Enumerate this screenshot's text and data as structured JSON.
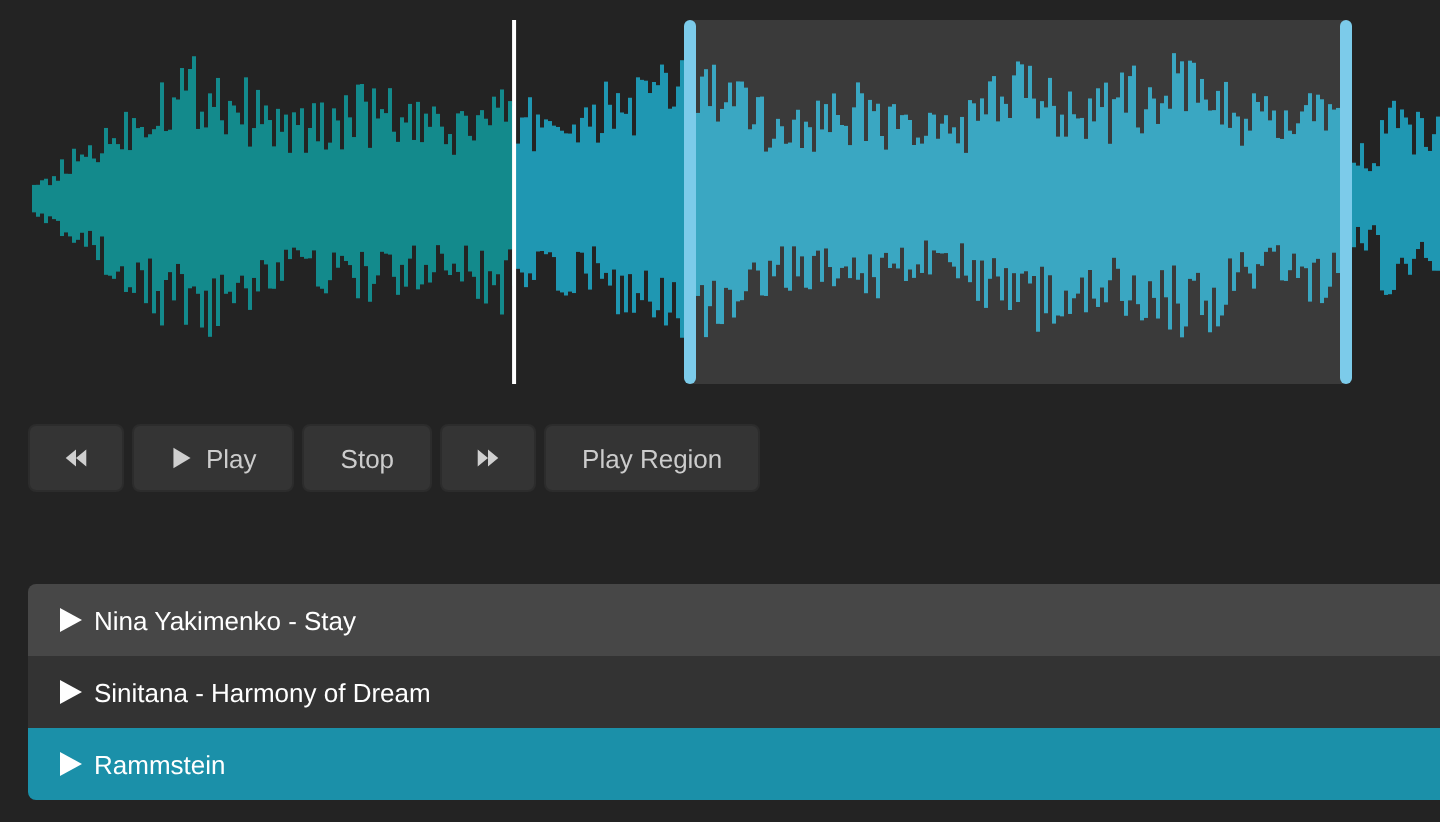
{
  "waveform": {
    "playhead": {
      "level": 0.357
    }
  },
  "controls": [
    {
      "kind": "rewind"
    },
    {
      "kind": "play",
      "label": "Play"
    },
    {
      "kind": "stop",
      "label": "Stop"
    },
    {
      "kind": "forward"
    },
    {
      "kind": "region",
      "label": "Play Region"
    }
  ],
  "playlist": [
    {
      "title": "Nina Yakimenko - Stay",
      "selected": false
    },
    {
      "title": "Sinitana - Harmony of Dream",
      "selected": false
    },
    {
      "title": "Rammstein",
      "selected": true
    }
  ]
}
